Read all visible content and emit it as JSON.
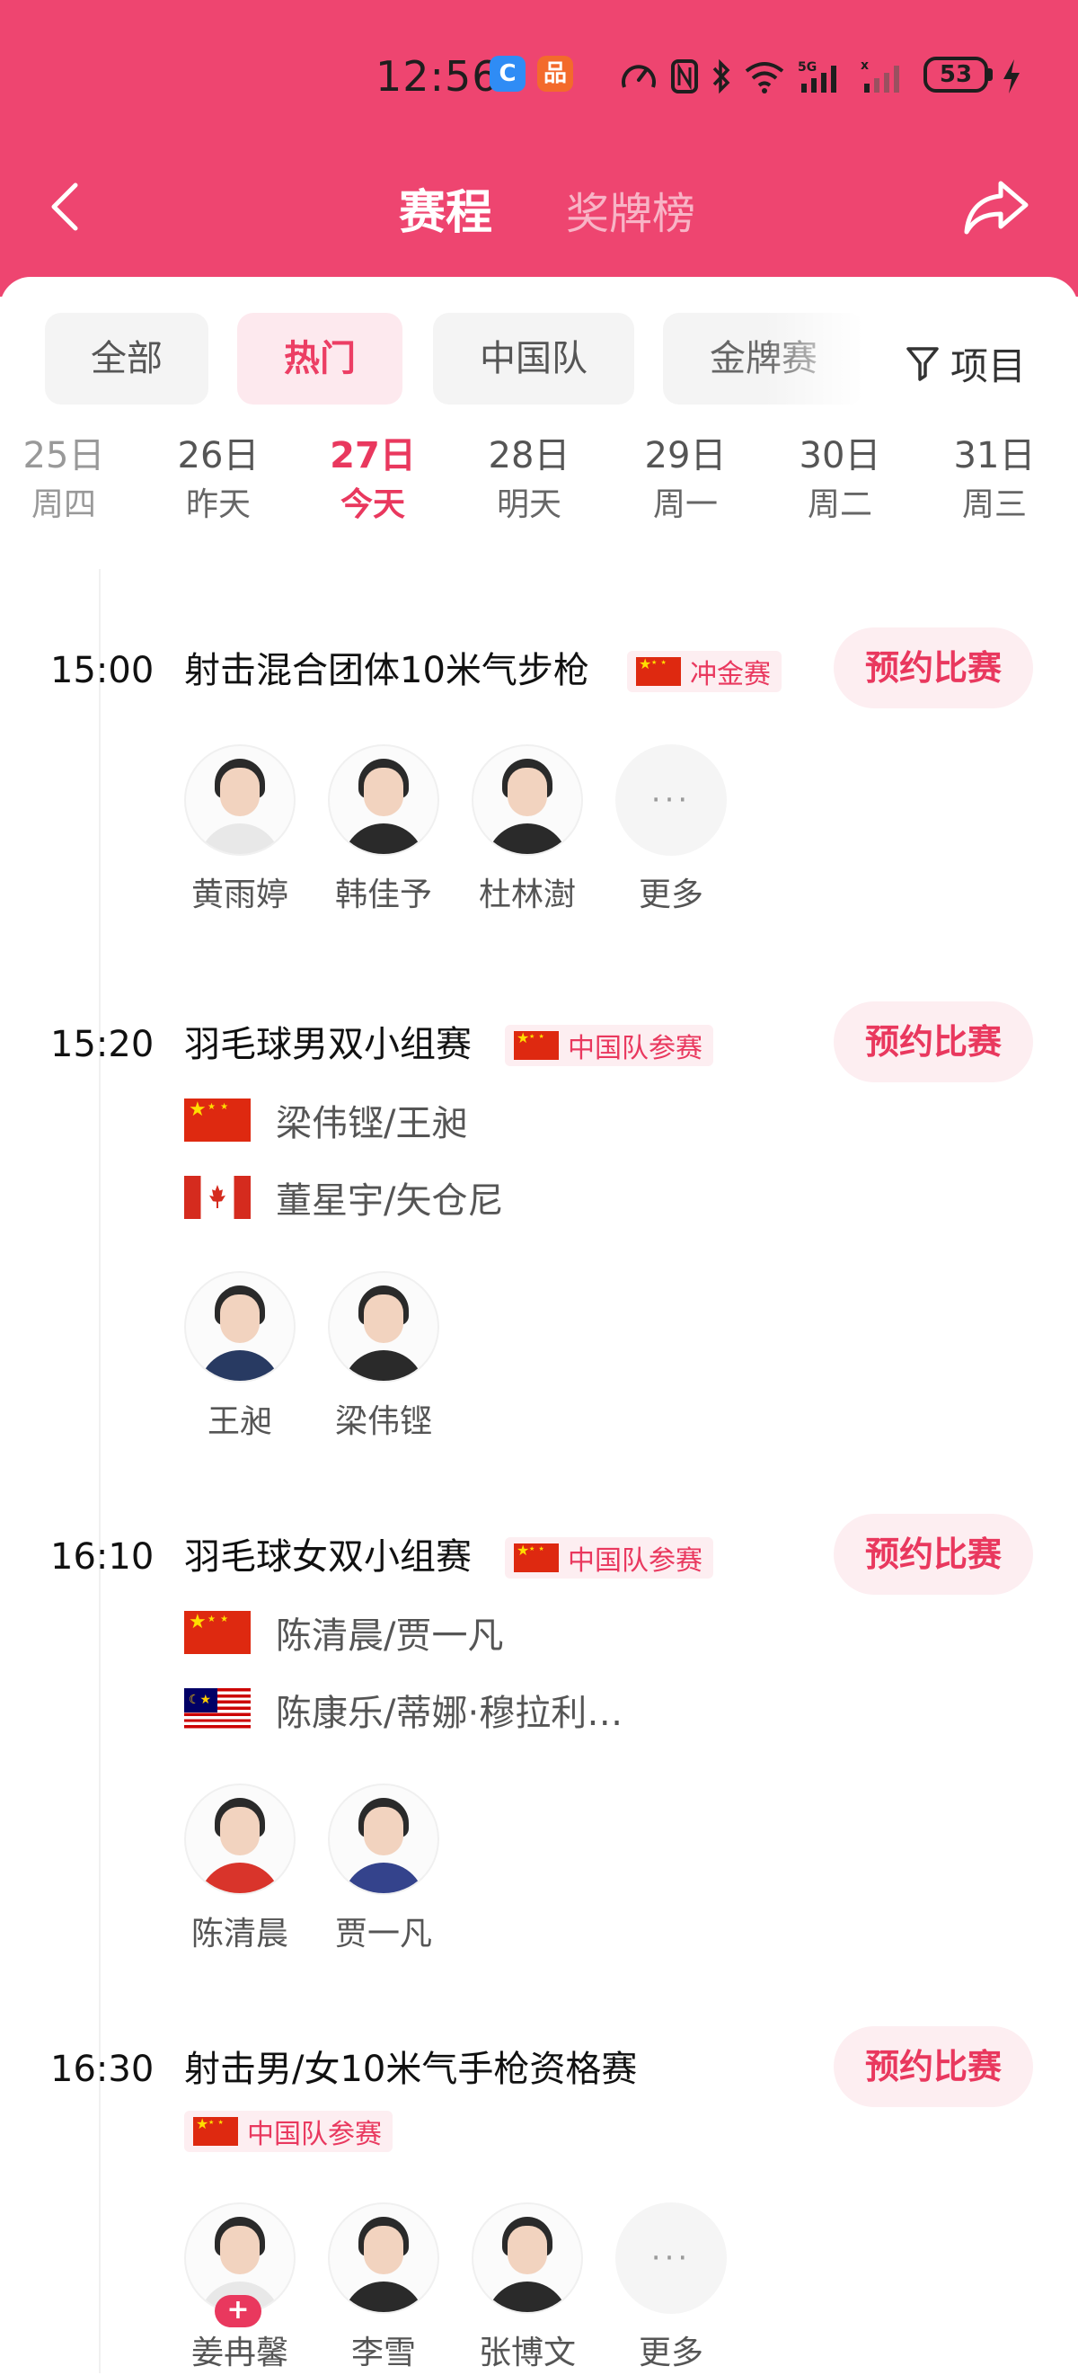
{
  "status_bar": {
    "time": "12:56",
    "battery": "53"
  },
  "nav": {
    "active_tab": "赛程",
    "inactive_tab": "奖牌榜"
  },
  "filters": {
    "chips": [
      "全部",
      "热门",
      "中国队",
      "金牌赛"
    ],
    "active_chip": "热门",
    "filter_label": "项目"
  },
  "dates": [
    {
      "day": "25日",
      "week": "周四"
    },
    {
      "day": "26日",
      "week": "昨天"
    },
    {
      "day": "27日",
      "week": "今天",
      "active": true
    },
    {
      "day": "28日",
      "week": "明天"
    },
    {
      "day": "29日",
      "week": "周一"
    },
    {
      "day": "30日",
      "week": "周二"
    },
    {
      "day": "31日",
      "week": "周三"
    }
  ],
  "colors": {
    "header": "#ee4570",
    "accent": "#e9385e",
    "chip_active_bg": "#fde9ee"
  },
  "events": [
    {
      "time": "15:00",
      "title": "射击混合团体10米气步枪",
      "badge": "冲金赛",
      "reserve_label": "预约比赛",
      "athletes": [
        "黄雨婷",
        "韩佳予",
        "杜林澍",
        "更多"
      ]
    },
    {
      "time": "15:20",
      "title": "羽毛球男双小组赛",
      "badge": "中国队参赛",
      "reserve_label": "预约比赛",
      "teams": [
        {
          "flag": "china-flag-icon",
          "names": "梁伟铿/王昶"
        },
        {
          "flag": "canada-flag-icon",
          "names": "董星宇/矢仓尼"
        }
      ],
      "athletes": [
        "王昶",
        "梁伟铿"
      ]
    },
    {
      "time": "16:10",
      "title": "羽毛球女双小组赛",
      "badge": "中国队参赛",
      "reserve_label": "预约比赛",
      "teams": [
        {
          "flag": "china-flag-icon",
          "names": "陈清晨/贾一凡"
        },
        {
          "flag": "malaysia-flag-icon",
          "names": "陈康乐/蒂娜·穆拉利…"
        }
      ],
      "athletes": [
        "陈清晨",
        "贾一凡"
      ]
    },
    {
      "time": "16:30",
      "title": "射击男/女10米气手枪资格赛",
      "badge": "中国队参赛",
      "reserve_label": "预约比赛",
      "athletes": [
        "姜冉馨",
        "李雪",
        "张博文",
        "更多"
      ]
    }
  ]
}
